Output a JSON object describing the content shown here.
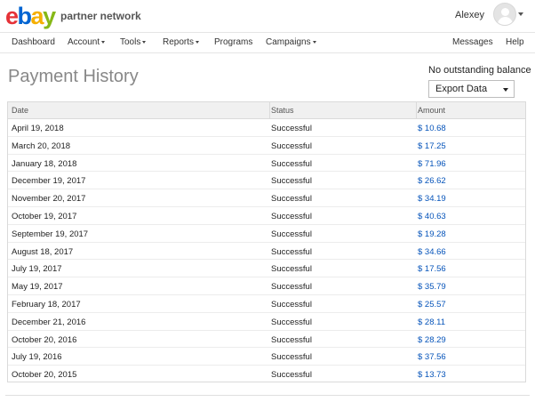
{
  "header": {
    "logo": {
      "e": "e",
      "b": "b",
      "a": "a",
      "y": "y"
    },
    "brand_subtitle": "partner network",
    "username": "Alexey"
  },
  "nav": {
    "items": [
      {
        "label": "Dashboard",
        "dropdown": false
      },
      {
        "label": "Account",
        "dropdown": true
      },
      {
        "label": "Tools",
        "dropdown": true
      },
      {
        "label": "Reports",
        "dropdown": true
      },
      {
        "label": "Programs",
        "dropdown": false
      },
      {
        "label": "Campaigns",
        "dropdown": true
      }
    ],
    "right_items": [
      {
        "label": "Messages"
      },
      {
        "label": "Help"
      }
    ]
  },
  "page": {
    "title": "Payment History",
    "balance_text": "No outstanding balance",
    "export_label": "Export Data"
  },
  "table": {
    "headers": {
      "date": "Date",
      "status": "Status",
      "amount": "Amount"
    },
    "rows": [
      {
        "date": "April 19, 2018",
        "status": "Successful",
        "amount": "$ 10.68"
      },
      {
        "date": "March 20, 2018",
        "status": "Successful",
        "amount": "$ 17.25"
      },
      {
        "date": "January 18, 2018",
        "status": "Successful",
        "amount": "$ 71.96"
      },
      {
        "date": "December 19, 2017",
        "status": "Successful",
        "amount": "$ 26.62"
      },
      {
        "date": "November 20, 2017",
        "status": "Successful",
        "amount": "$ 34.19"
      },
      {
        "date": "October 19, 2017",
        "status": "Successful",
        "amount": "$ 40.63"
      },
      {
        "date": "September 19, 2017",
        "status": "Successful",
        "amount": "$ 19.28"
      },
      {
        "date": "August 18, 2017",
        "status": "Successful",
        "amount": "$ 34.66"
      },
      {
        "date": "July 19, 2017",
        "status": "Successful",
        "amount": "$ 17.56"
      },
      {
        "date": "May 19, 2017",
        "status": "Successful",
        "amount": "$ 35.79"
      },
      {
        "date": "February 18, 2017",
        "status": "Successful",
        "amount": "$ 25.57"
      },
      {
        "date": "December 21, 2016",
        "status": "Successful",
        "amount": "$ 28.11"
      },
      {
        "date": "October 20, 2016",
        "status": "Successful",
        "amount": "$ 28.29"
      },
      {
        "date": "July 19, 2016",
        "status": "Successful",
        "amount": "$ 37.56"
      },
      {
        "date": "October 20, 2015",
        "status": "Successful",
        "amount": "$ 13.73"
      }
    ]
  },
  "icons": {
    "avatar": "user-avatar-icon",
    "caret": "chevron-down-icon"
  }
}
